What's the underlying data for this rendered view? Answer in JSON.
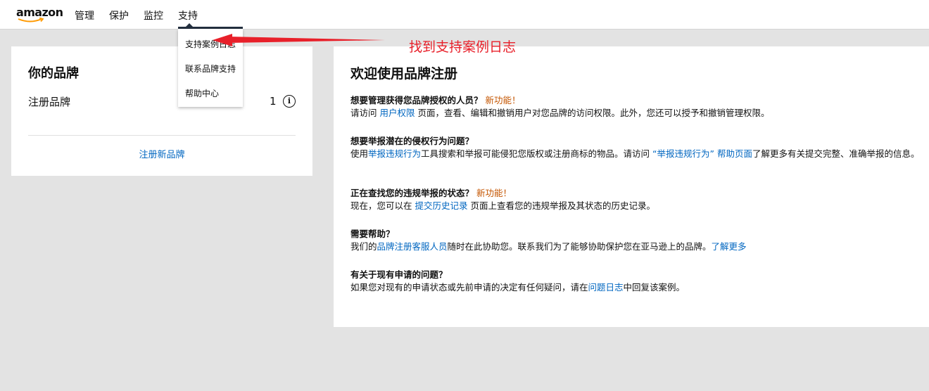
{
  "nav": {
    "logo": "amazon",
    "items": [
      "管理",
      "保护",
      "监控",
      "支持"
    ]
  },
  "dropdown": {
    "items": [
      "支持案例日志",
      "联系品牌支持",
      "帮助中心"
    ]
  },
  "brand_card": {
    "title": "你的品牌",
    "registered_label": "注册品牌",
    "registered_count": "1",
    "info_glyph": "i",
    "register_link": "注册新品牌"
  },
  "welcome": {
    "title": "欢迎使用品牌注册",
    "sections": [
      {
        "question": "想要管理获得您品牌授权的人员？",
        "badge": "新功能！",
        "p1": "请访问 ",
        "link1": "用户权限",
        "p2": " 页面，查看、编辑和撤销用户对您品牌的访问权限。此外，您还可以授予和撤销管理权限。"
      },
      {
        "question": "想要举报潜在的侵权行为问题？",
        "p1": "使用",
        "link1": "举报违规行为",
        "p2": "工具搜索和举报可能侵犯您版权或注册商标的物品。请访问 ",
        "link2": "“举报违规行为” 帮助页面",
        "p3": "了解更多有关提交完整、准确举报的信息。"
      },
      {
        "question": "正在查找您的违规举报的状态？",
        "badge": "新功能！",
        "p1": "现在，您可以在 ",
        "link1": "提交历史记录",
        "p2": " 页面上查看您的违规举报及其状态的历史记录。"
      },
      {
        "question": "需要帮助？",
        "p1": "我们的",
        "link1": "品牌注册客服人员",
        "p2": "随时在此协助您。联系我们为了能够协助保护您在亚马逊上的品牌。",
        "link2": "了解更多"
      },
      {
        "question": "有关于现有申请的问题？",
        "p1": "如果您对现有的申请状态或先前申请的决定有任何疑问，请在",
        "link1": "问题日志",
        "p2": "中回复该案例。"
      }
    ]
  },
  "annotation": {
    "text": "找到支持案例日志",
    "color": "#e8202a"
  },
  "colors": {
    "link": "#0066c0",
    "badge": "#c45500",
    "background": "#e3e3e3"
  }
}
